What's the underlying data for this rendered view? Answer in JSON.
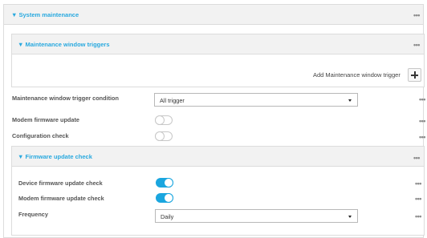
{
  "system_maintenance": {
    "title": "▼ System maintenance",
    "more": "•••"
  },
  "maintenance_window_triggers": {
    "title": "▼ Maintenance window triggers",
    "more": "•••",
    "add_label": "Add Maintenance window trigger"
  },
  "trigger_condition": {
    "label": "Maintenance window trigger condition",
    "value": "All trigger",
    "more": "•••"
  },
  "modem_firmware_update": {
    "label": "Modem firmware update",
    "enabled": false,
    "more": "•••"
  },
  "configuration_check": {
    "label": "Configuration check",
    "enabled": false,
    "more": "•••"
  },
  "firmware_update_check": {
    "title": "▼ Firmware update check",
    "more": "•••",
    "device_check": {
      "label": "Device firmware update check",
      "enabled": true,
      "more": "•••"
    },
    "modem_check": {
      "label": "Modem firmware update check",
      "enabled": true,
      "more": "•••"
    },
    "frequency": {
      "label": "Frequency",
      "value": "Daily",
      "more": "•••"
    }
  },
  "colors": {
    "accent": "#29a9df",
    "toggle_on": "#1aa6df",
    "header_bg": "#f2f2f2",
    "border": "#dcdcdc"
  }
}
